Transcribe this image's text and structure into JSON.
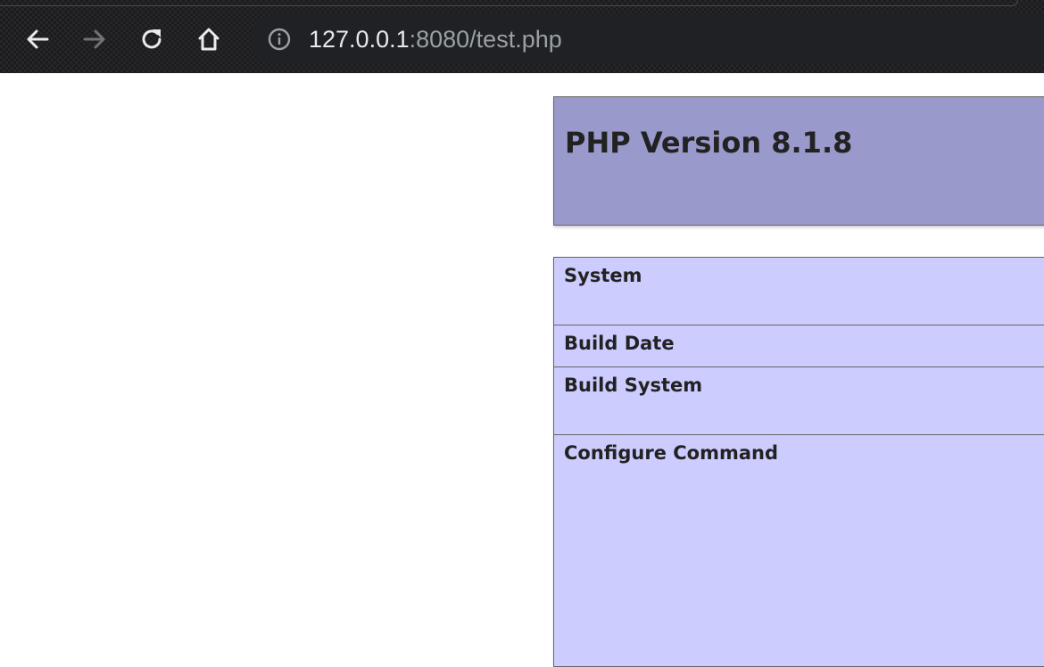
{
  "browser": {
    "nav": {
      "back_icon": "arrow-left-icon",
      "forward_icon": "arrow-right-icon",
      "reload_icon": "reload-icon",
      "home_icon": "home-icon"
    },
    "address_bar": {
      "info_icon": "info-circle-icon",
      "url_host": "127.0.0.1",
      "url_rest": ":8080/test.php"
    },
    "colors": {
      "toolbar_bg": "#1c1c1e",
      "omnibox_bg": "#202124",
      "icon_active": "#e8eaed",
      "icon_disabled": "#6f7276"
    }
  },
  "page": {
    "header": {
      "title": "PHP Version 8.1.8",
      "color": "#9999cc"
    },
    "table": {
      "color": "#ccccff",
      "rows": [
        {
          "label": "System",
          "value": ""
        },
        {
          "label": "Build Date",
          "value": ""
        },
        {
          "label": "Build System",
          "value": ""
        },
        {
          "label": "Configure Command",
          "value": ""
        }
      ]
    }
  }
}
